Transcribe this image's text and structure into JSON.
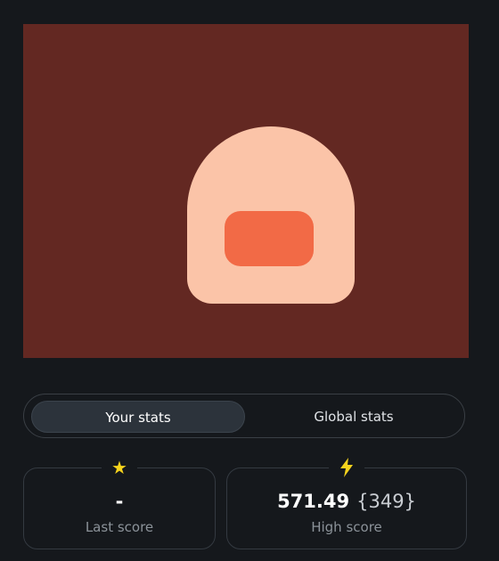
{
  "game": {
    "colors": {
      "background": "#632822",
      "mascot_body": "#fbc4a8",
      "mascot_mouth": "#f26a46"
    }
  },
  "tabs": {
    "items": [
      {
        "label": "Your stats",
        "active": true
      },
      {
        "label": "Global stats",
        "active": false
      }
    ]
  },
  "stats": {
    "last_score": {
      "icon": "star-icon",
      "value": "-",
      "label": "Last score"
    },
    "high_score": {
      "icon": "lightning-bolt-icon",
      "value": "571.49",
      "rank": "{349}",
      "label": "High score"
    }
  },
  "accent_colors": {
    "icon_yellow": "#f5d31d",
    "panel_bg": "#15181c",
    "border": "#343a41"
  }
}
